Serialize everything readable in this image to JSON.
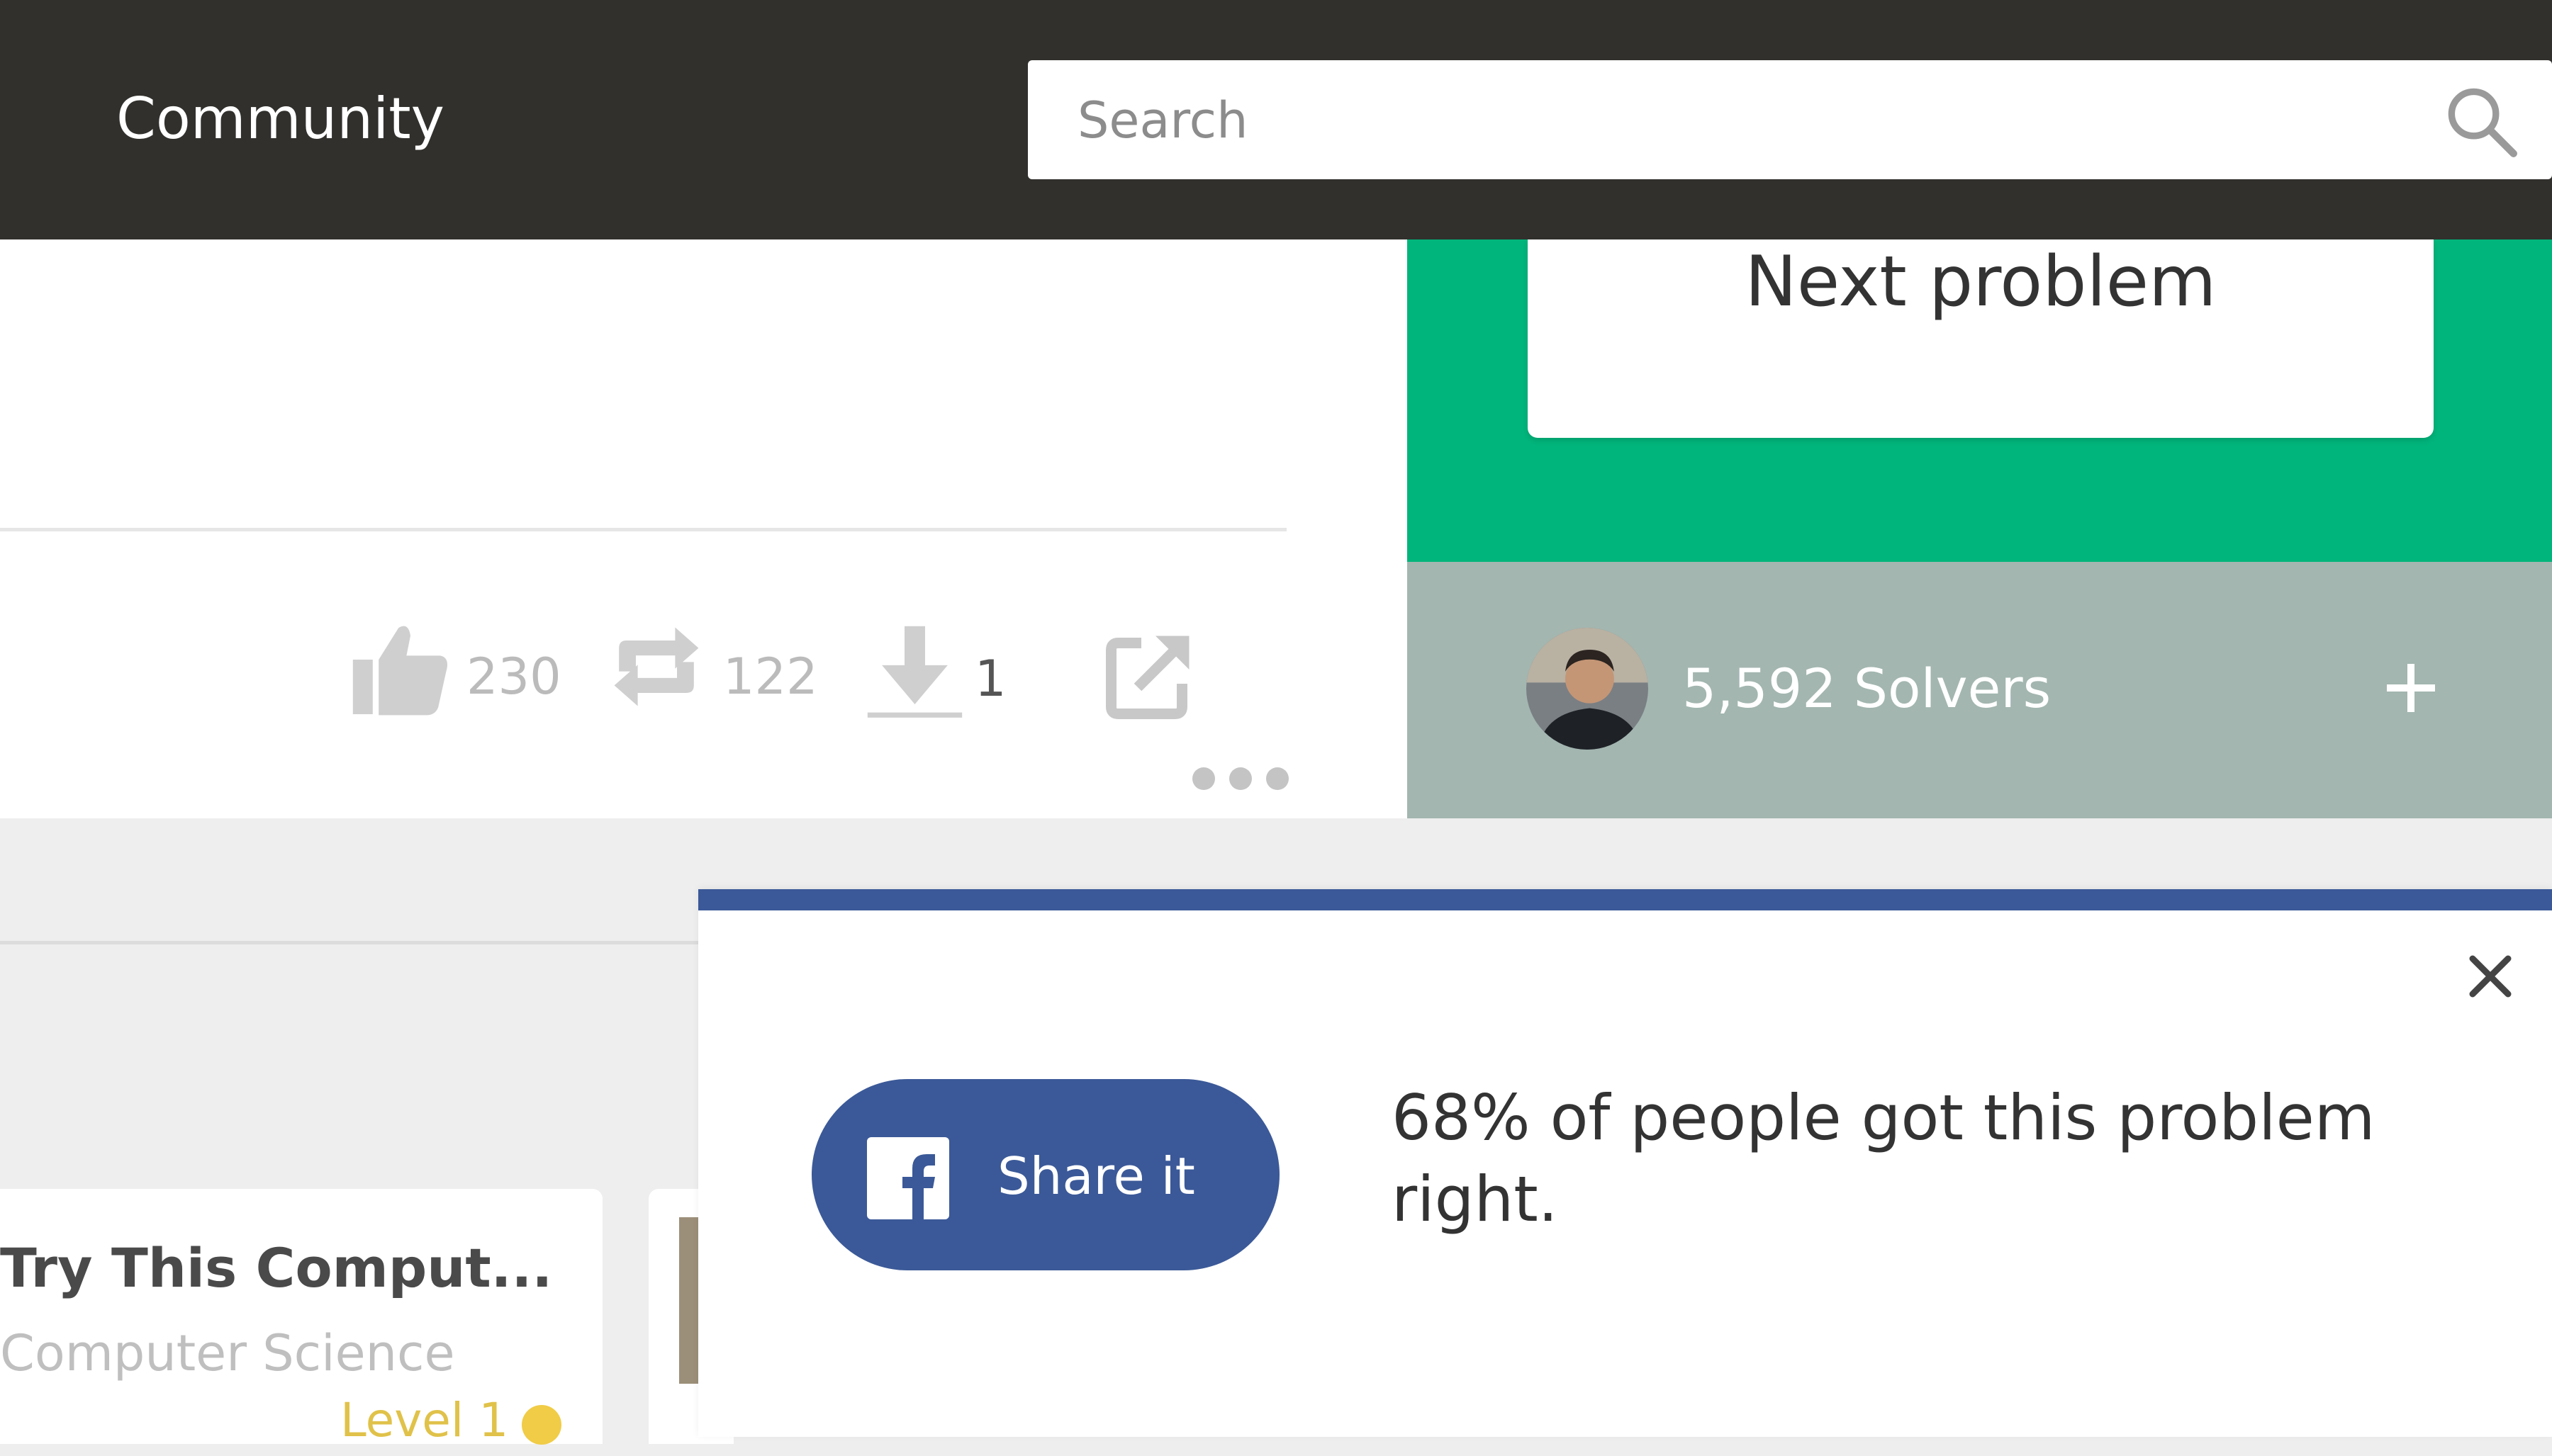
{
  "header": {
    "title": "Community",
    "search_placeholder": "Search"
  },
  "problem": {
    "stats": [
      {
        "icon": "thumbs-up-icon",
        "count": "230"
      },
      {
        "icon": "reshare-icon",
        "count": "122"
      },
      {
        "icon": "download-icon",
        "count": "1"
      }
    ]
  },
  "sidebar": {
    "next_problem_label": "Next problem",
    "solvers_label": "5,592 Solvers"
  },
  "suggestion": {
    "title": "Try This Comput...",
    "subject": "Computer Science",
    "level": "Level 1"
  },
  "share_modal": {
    "button_label": "Share it",
    "message": "68% of people got this problem right."
  },
  "colors": {
    "header_bg": "#31302d",
    "accent_green": "#00b57b",
    "solvers_bg": "#a3b6b0",
    "facebook_blue": "#3b5998",
    "level_yellow": "#f0cc47"
  }
}
